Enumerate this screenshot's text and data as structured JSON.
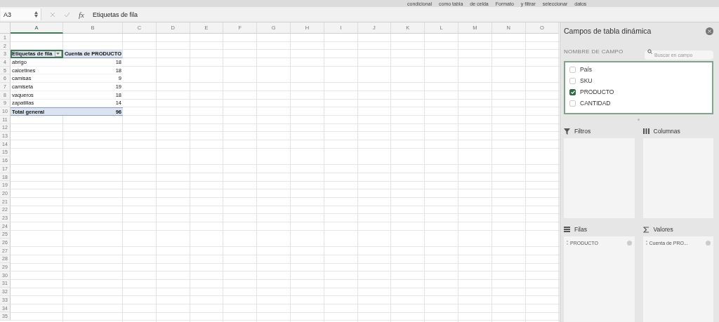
{
  "ribbon": [
    "condicional",
    "como tabla",
    "de celda",
    "Formato",
    "y filtrar",
    "seleccionar",
    "datos"
  ],
  "formula_bar": {
    "name_box": "A3",
    "function_symbol": "fx",
    "value": "Etiquetas de fila"
  },
  "sheet": {
    "columns": [
      {
        "label": "A",
        "selected": true
      },
      {
        "label": "B",
        "selected": false
      },
      {
        "label": "C",
        "selected": false
      },
      {
        "label": "D",
        "selected": false
      },
      {
        "label": "E",
        "selected": false
      },
      {
        "label": "F",
        "selected": false
      },
      {
        "label": "G",
        "selected": false
      },
      {
        "label": "H",
        "selected": false
      },
      {
        "label": "I",
        "selected": false
      },
      {
        "label": "J",
        "selected": false
      },
      {
        "label": "K",
        "selected": false
      },
      {
        "label": "L",
        "selected": false
      },
      {
        "label": "M",
        "selected": false
      },
      {
        "label": "N",
        "selected": false
      },
      {
        "label": "O",
        "selected": false
      }
    ],
    "rows": [
      {
        "number": "1",
        "kind": "empty"
      },
      {
        "number": "2",
        "kind": "empty"
      },
      {
        "number": "3",
        "kind": "header",
        "cells": [
          "Etiquetas de fila",
          "Cuenta de PRODUCTO"
        ]
      },
      {
        "number": "4",
        "kind": "item",
        "cells": [
          "abrigo",
          "18"
        ]
      },
      {
        "number": "5",
        "kind": "item",
        "cells": [
          "calcetines",
          "18"
        ]
      },
      {
        "number": "6",
        "kind": "item",
        "cells": [
          "camisas",
          "9"
        ]
      },
      {
        "number": "7",
        "kind": "item",
        "cells": [
          "camiseta",
          "19"
        ]
      },
      {
        "number": "8",
        "kind": "item",
        "cells": [
          "vaqueros",
          "18"
        ]
      },
      {
        "number": "9",
        "kind": "item",
        "cells": [
          "zapatillas",
          "14"
        ]
      },
      {
        "number": "10",
        "kind": "total",
        "cells": [
          "Total general",
          "96"
        ]
      },
      {
        "number": "11",
        "kind": "empty"
      },
      {
        "number": "12",
        "kind": "empty"
      },
      {
        "number": "13",
        "kind": "empty"
      },
      {
        "number": "14",
        "kind": "empty"
      },
      {
        "number": "15",
        "kind": "empty"
      },
      {
        "number": "16",
        "kind": "empty"
      },
      {
        "number": "17",
        "kind": "empty"
      },
      {
        "number": "18",
        "kind": "empty"
      },
      {
        "number": "19",
        "kind": "empty"
      },
      {
        "number": "20",
        "kind": "empty"
      },
      {
        "number": "21",
        "kind": "empty"
      },
      {
        "number": "22",
        "kind": "empty"
      },
      {
        "number": "23",
        "kind": "empty"
      },
      {
        "number": "24",
        "kind": "empty"
      },
      {
        "number": "25",
        "kind": "empty"
      },
      {
        "number": "26",
        "kind": "empty"
      },
      {
        "number": "27",
        "kind": "empty"
      },
      {
        "number": "28",
        "kind": "empty"
      },
      {
        "number": "29",
        "kind": "empty"
      },
      {
        "number": "30",
        "kind": "empty"
      },
      {
        "number": "31",
        "kind": "empty"
      },
      {
        "number": "32",
        "kind": "empty"
      },
      {
        "number": "33",
        "kind": "empty"
      },
      {
        "number": "34",
        "kind": "empty"
      },
      {
        "number": "35",
        "kind": "empty"
      }
    ]
  },
  "pivot_panel": {
    "title": "Campos de tabla dinámica",
    "field_name_label": "NOMBRE DE CAMPO",
    "search": {
      "placeholder": "Buscar en campo"
    },
    "fields": [
      {
        "label": "País",
        "checked": false
      },
      {
        "label": "SKU",
        "checked": false
      },
      {
        "label": "PRODUCTO",
        "checked": true
      },
      {
        "label": "CANTIDAD",
        "checked": false
      }
    ],
    "areas": [
      {
        "kind": "filters",
        "label": "Filtros"
      },
      {
        "kind": "columns",
        "label": "Columnas"
      },
      {
        "kind": "rows",
        "label": "Filas",
        "items": [
          "PRODUCTO"
        ]
      },
      {
        "kind": "values",
        "label": "Valores",
        "items": [
          "Cuenta de PRO..."
        ]
      }
    ]
  }
}
